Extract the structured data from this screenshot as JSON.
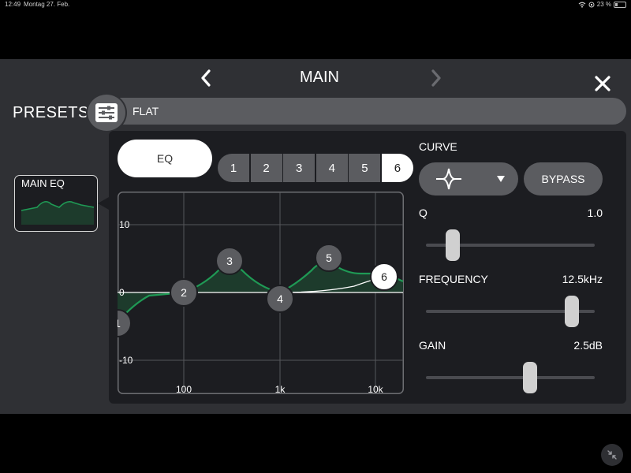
{
  "status_bar": {
    "time": "12:49",
    "date": "Montag 27. Feb.",
    "battery": "23 %"
  },
  "nav": {
    "title": "MAIN"
  },
  "presets": {
    "label": "PRESETS",
    "current": "FLAT"
  },
  "thumbnail": {
    "label": "MAIN EQ"
  },
  "mode_button": {
    "label": "EQ"
  },
  "bands": [
    {
      "label": "1",
      "active": false
    },
    {
      "label": "2",
      "active": false
    },
    {
      "label": "3",
      "active": false
    },
    {
      "label": "4",
      "active": false
    },
    {
      "label": "5",
      "active": false
    },
    {
      "label": "6",
      "active": true
    }
  ],
  "graph": {
    "y_ticks": [
      "10",
      "0",
      "-10"
    ],
    "x_ticks": [
      "100",
      "1k",
      "10k"
    ],
    "nodes": [
      "1",
      "2",
      "3",
      "4",
      "5",
      "6"
    ],
    "selected_node": "6",
    "accent_color": "#1f9a55"
  },
  "controls": {
    "curve_label": "CURVE",
    "curve_icon": "bell-curve-icon",
    "bypass_label": "BYPASS",
    "q": {
      "label": "Q",
      "value": "1.0",
      "level": 0.13
    },
    "frequency": {
      "label": "FREQUENCY",
      "value": "12.5kHz",
      "level": 0.9
    },
    "gain": {
      "label": "GAIN",
      "value": "2.5dB",
      "level": 0.63
    }
  }
}
